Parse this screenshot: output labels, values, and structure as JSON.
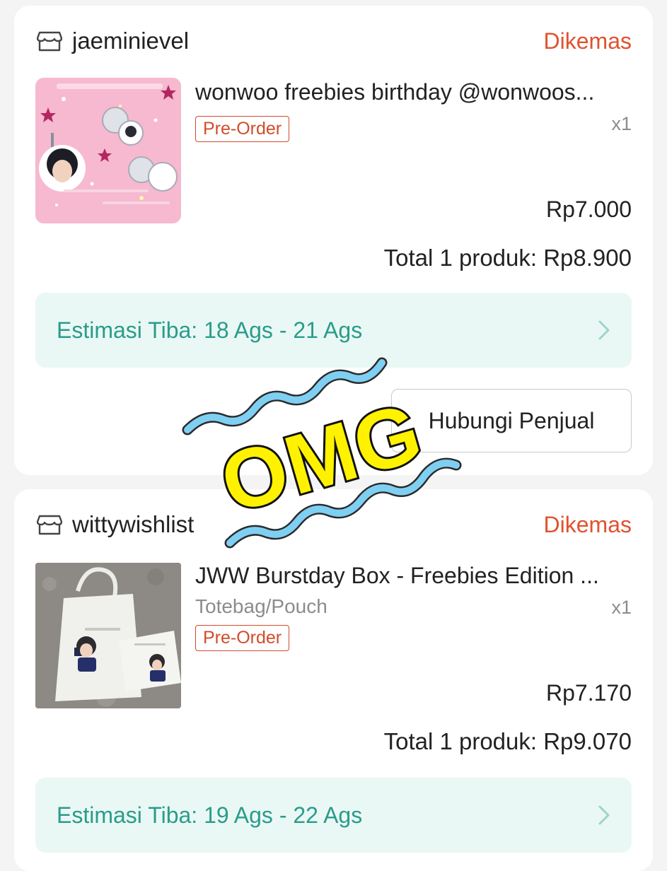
{
  "orders": [
    {
      "shop": "jaeminievel",
      "status": "Dikemas",
      "title": "wonwoo freebies birthday @wonwoos...",
      "variant": "",
      "badge": "Pre-Order",
      "qty": "x1",
      "price": "Rp7.000",
      "total": "Total 1 produk: Rp8.900",
      "estimasi": "Estimasi Tiba: 18 Ags - 21 Ags",
      "contact_button": "Hubungi Penjual"
    },
    {
      "shop": "wittywishlist",
      "status": "Dikemas",
      "title": "JWW Burstday Box - Freebies Edition ...",
      "variant": "Totebag/Pouch",
      "badge": "Pre-Order",
      "qty": "x1",
      "price": "Rp7.170",
      "total": "Total 1 produk: Rp9.070",
      "estimasi": "Estimasi Tiba: 19 Ags - 22 Ags"
    }
  ],
  "overlay": {
    "text": "OMG"
  },
  "colors": {
    "status": "#e0522e",
    "estimasi_text": "#2a9c8a",
    "estimasi_bg": "#eaf8f5",
    "overlay_fill": "#fff200",
    "overlay_wave": "#7fcff2"
  },
  "icons": {
    "shop": "store-icon",
    "chevron": "chevron-right-icon"
  }
}
